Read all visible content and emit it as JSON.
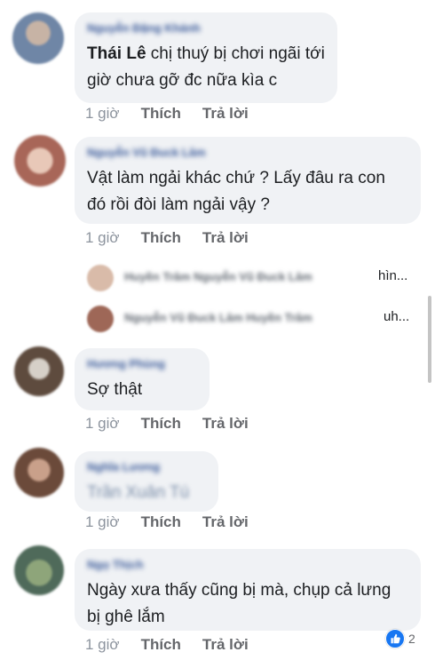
{
  "comments": [
    {
      "author": "Nguyễn Đặng Khánh",
      "mention": "Thái Lê",
      "text": " chị thuý bị chơi ngãi tới giờ chưa gỡ đc nữa kìa c",
      "time": "1 giờ",
      "like": "Thích",
      "reply": "Trả lời",
      "avatar_color": "#9aa7b8"
    },
    {
      "author": "Nguyễn Vũ Đuck Lâm",
      "text": "Vật làm ngải khác chứ ? Lấy đâu ra con đó rồi đòi làm ngải vậy ?",
      "time": "1 giờ",
      "like": "Thích",
      "reply": "Trả lời",
      "avatar_color": "#b87a6e"
    },
    {
      "author": "Hương Phùng",
      "text": "Sợ thật",
      "time": "1 giờ",
      "like": "Thích",
      "reply": "Trả lời",
      "avatar_color": "#6b5a4a"
    },
    {
      "author": "Nghĩa Lương",
      "text": "Trần Xuân Tú",
      "time": "1 giờ",
      "like": "Thích",
      "reply": "Trả lời",
      "avatar_color": "#8a6a58"
    },
    {
      "author": "Ngọ Thịch",
      "text": "Ngày xưa thấy cũng bị mà, chụp cả lưng bị ghê lắm",
      "time": "1 giờ",
      "like": "Thích",
      "reply": "Trả lời",
      "avatar_color": "#7a8c6a"
    }
  ],
  "replies": [
    {
      "names": "Huyền Trâm  Nguyễn Vũ Đuck Lâm",
      "tail": "hìn...",
      "avatar_color": "#d8b9a8"
    },
    {
      "names": "Nguyễn Vũ Đuck Lâm  Huyền Trâm",
      "tail": "uh...",
      "avatar_color": "#a06a5a"
    }
  ],
  "reaction": {
    "icon": "like-icon",
    "count": "2",
    "color": "#1877f2"
  }
}
